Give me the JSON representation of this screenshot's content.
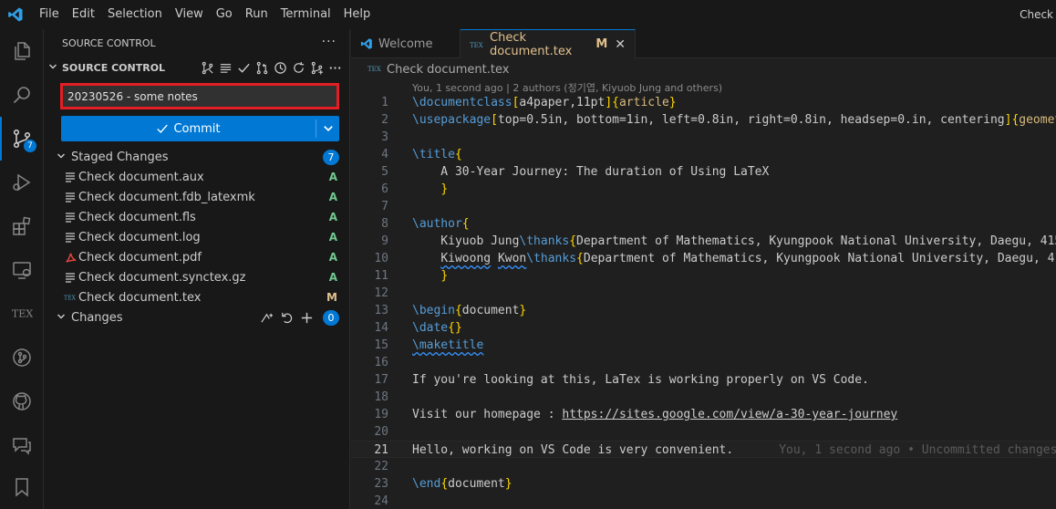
{
  "menu": [
    "File",
    "Edit",
    "Selection",
    "View",
    "Go",
    "Run",
    "Terminal",
    "Help"
  ],
  "window_title": "Check",
  "activity": {
    "source_control_badge": "7"
  },
  "sidebar": {
    "title": "SOURCE CONTROL",
    "section": "SOURCE CONTROL",
    "commit_message": "20230526 - some notes",
    "commit_label": "Commit",
    "staged": {
      "label": "Staged Changes",
      "count": "7",
      "files": [
        {
          "name": "Check document.aux",
          "status": "A",
          "icon": "file-lines-icon"
        },
        {
          "name": "Check document.fdb_latexmk",
          "status": "A",
          "icon": "file-lines-icon"
        },
        {
          "name": "Check document.fls",
          "status": "A",
          "icon": "file-lines-icon"
        },
        {
          "name": "Check document.log",
          "status": "A",
          "icon": "file-lines-icon"
        },
        {
          "name": "Check document.pdf",
          "status": "A",
          "icon": "pdf-icon"
        },
        {
          "name": "Check document.synctex.gz",
          "status": "A",
          "icon": "file-lines-icon"
        },
        {
          "name": "Check document.tex",
          "status": "M",
          "icon": "tex-icon"
        }
      ]
    },
    "changes": {
      "label": "Changes",
      "count": "0"
    }
  },
  "tabs": [
    {
      "label": "Welcome"
    },
    {
      "label": "Check document.tex",
      "modified": "M"
    }
  ],
  "breadcrumb": "Check document.tex",
  "editor": {
    "blame_header": "You, 1 second ago | 2 authors (정기엽, Kiyuob Jung and others)",
    "inline_blame": "You, 1 second ago • Uncommitted changes",
    "line_numbers": [
      "1",
      "2",
      "3",
      "4",
      "5",
      "6",
      "7",
      "8",
      "9",
      "10",
      "11",
      "12",
      "13",
      "14",
      "15",
      "16",
      "17",
      "18",
      "19",
      "20",
      "21",
      "22",
      "23",
      "24"
    ]
  },
  "colors": {
    "accent": "#0078d4",
    "highlight_border": "#e31e24",
    "added": "#73c991",
    "modified": "#e2c08d"
  }
}
